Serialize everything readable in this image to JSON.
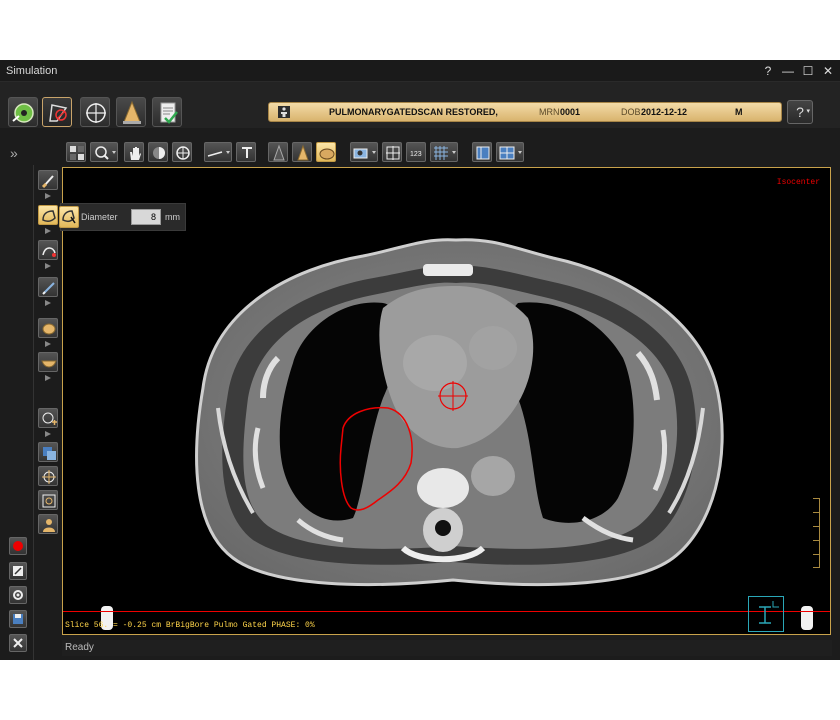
{
  "window": {
    "title": "Simulation",
    "controls": [
      "?",
      "—",
      "☐",
      "✕"
    ]
  },
  "patient_banner": {
    "status": "PULMONARYGATEDSCAN RESTORED,",
    "mrn_label": "MRN",
    "mrn": "0001",
    "dob_label": "DOB",
    "dob": "2012-12-12",
    "sex": "M"
  },
  "help": {
    "label": "?"
  },
  "sidebar": {
    "expand_label": "»"
  },
  "tool_popup": {
    "label": "Diameter",
    "value": "8",
    "unit": "mm"
  },
  "viewport": {
    "isocenter_label": "Isocenter",
    "slice_info": "Slice 56.  = -0.25 cm BrBigBore Pulmo Gated     PHASE: 0%"
  },
  "status": {
    "text": "Ready"
  },
  "colors": {
    "accent": "#c8a24b",
    "banner_top": "#f3dba8",
    "banner_bottom": "#d9b46e",
    "contour": "#e00000",
    "overlay_text": "#ffd54a"
  }
}
